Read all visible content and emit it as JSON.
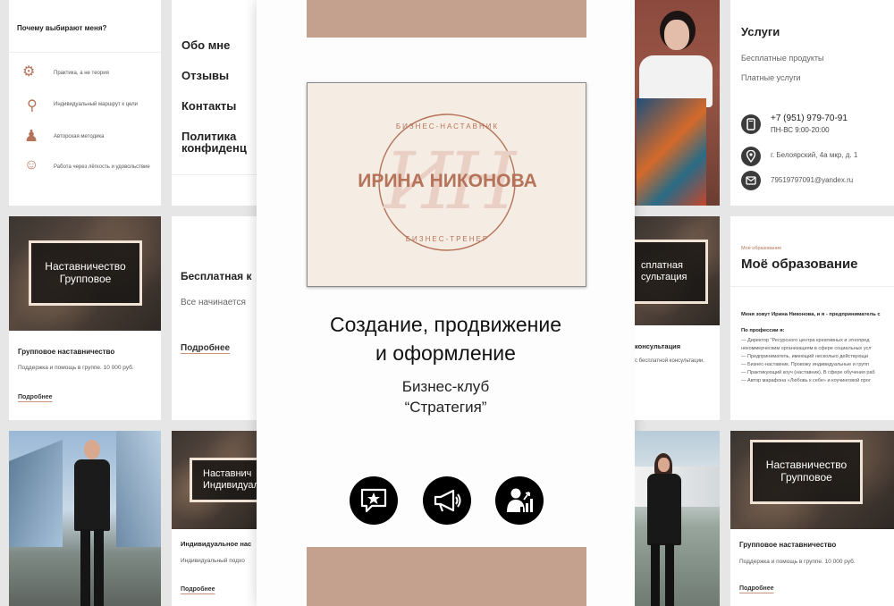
{
  "left_top": {
    "title": "Почему выбирают меня?",
    "items": [
      "Практика, а не теория",
      "Индивидуальный маршрут к цели",
      "Авторская методика",
      "Работа через лёгкость и удовольствие"
    ]
  },
  "left_mid": {
    "overlay": "Наставничество Групповое",
    "title": "Групповое наставничество",
    "desc": "Поддержка и помощь в группе. 10 000 руб.",
    "link": "Подробнее"
  },
  "menu": {
    "items": [
      "Обо мне",
      "Отзывы",
      "Контакты",
      "Политика конфиденц"
    ]
  },
  "mid_card": {
    "title": "Бесплатная к",
    "desc": "Все начинается",
    "link": "Подробнее"
  },
  "indiv_card": {
    "overlay": "Наставнич Индивидуаль",
    "title": "Индивидуальное нас",
    "desc": "Индивидуальный подхо",
    "link": "Подробнее"
  },
  "center": {
    "logo_top": "БИЗНЕС-НАСТАВНИК",
    "logo_name": "ИРИНА НИКОНОВА",
    "logo_bottom": "БИЗНЕС-ТРЕНЕР",
    "logo_mono": "ИН",
    "headline1": "Создание, продвижение",
    "headline2": "и оформление",
    "sub1": "Бизнес-клуб",
    "sub2": "“Стратегия”",
    "icons": [
      "star-chat-icon",
      "megaphone-icon",
      "business-growth-icon"
    ]
  },
  "right_consult": {
    "overlay": "сплатная сультация",
    "title": "консультация",
    "desc": "с бесплатной консультации."
  },
  "services": {
    "title": "Услуги",
    "links": [
      "Бесплатные продукты",
      "Платные услуги"
    ],
    "phone": "+7 (951) 979-70-91",
    "hours": "ПН-ВС 9:00-20:00",
    "address": "г. Белоярский, 4а мкр, д. 1",
    "email": "79519797091@yandex.ru"
  },
  "education": {
    "kicker": "Моё образование",
    "title": "Моё образование",
    "intro": "Меня зовут Ирина Никонова, и я - предприниматель с",
    "prof_title": "По профессии я:",
    "lines": [
      "— Директор \"Ресурсного центра креативных и этнопред",
      "некоммерческим организациям в сфере социальных усл",
      "— Предприниматель, имеющий несколько действующи",
      "— Бизнес-наставник. Провожу индивидуальные и групп",
      "— Практикующий коуч (наставник). В сфере обучения раб",
      "— Автор марафона «Любовь к себе» и коучинговой прог"
    ]
  },
  "right_bottom": {
    "overlay": "Наставничество Групповое",
    "title": "Групповое наставничество",
    "desc": "Поддержка и помощь в группе. 10 000 руб.",
    "link": "Подробнее"
  },
  "colors": {
    "accent": "#c4a18e",
    "copper": "#b5745a",
    "cream": "#f5ece4"
  }
}
